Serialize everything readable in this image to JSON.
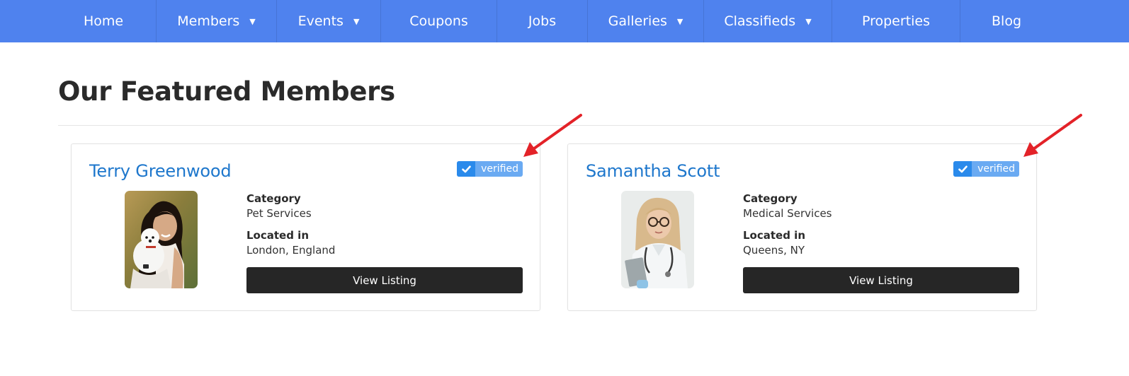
{
  "nav": {
    "items": [
      {
        "label": "Home",
        "dropdown": false
      },
      {
        "label": "Members",
        "dropdown": true
      },
      {
        "label": "Events",
        "dropdown": true
      },
      {
        "label": "Coupons",
        "dropdown": false
      },
      {
        "label": "Jobs",
        "dropdown": false
      },
      {
        "label": "Galleries",
        "dropdown": true
      },
      {
        "label": "Classifieds",
        "dropdown": true
      },
      {
        "label": "Properties",
        "dropdown": false
      },
      {
        "label": "Blog",
        "dropdown": false
      }
    ],
    "caret": "▼"
  },
  "page": {
    "title": "Our Featured Members"
  },
  "members": [
    {
      "name": "Terry Greenwood",
      "badge": "verified",
      "category_label": "Category",
      "category": "Pet Services",
      "location_label": "Located in",
      "location": "London, England",
      "button": "View Listing"
    },
    {
      "name": "Samantha Scott",
      "badge": "verified",
      "category_label": "Category",
      "category": "Medical Services",
      "location_label": "Located in",
      "location": "Queens, NY",
      "button": "View Listing"
    }
  ],
  "colors": {
    "nav_bg": "#4f82ee",
    "link": "#1e77cc",
    "badge_dark": "#2a8aeb",
    "badge_light": "#6aaaf2",
    "button": "#262626",
    "arrow": "#e32228"
  },
  "icons": [
    "check-icon",
    "annotation-arrow",
    "member-photo"
  ]
}
